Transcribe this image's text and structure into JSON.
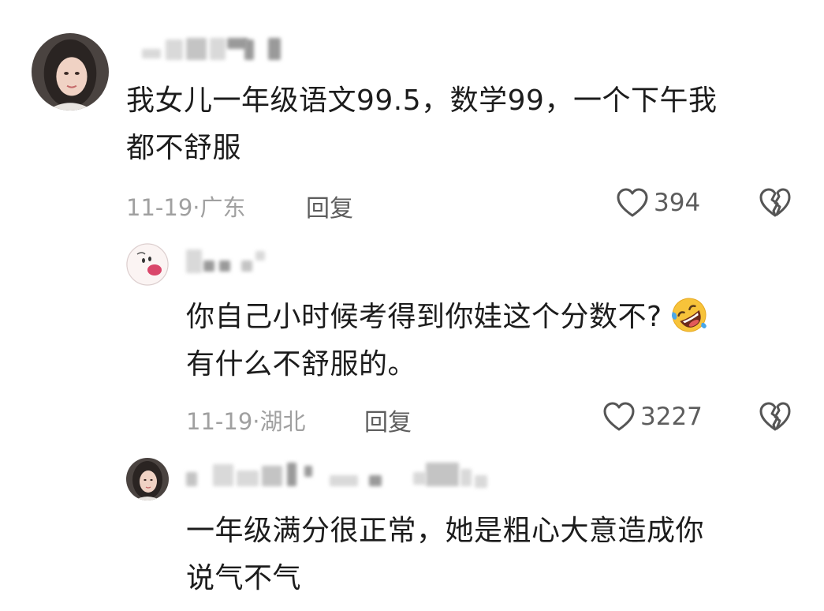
{
  "comments": [
    {
      "text_lines": [
        "我女儿一年级语文99.5，数学99，一个下午我",
        "都不舒服"
      ],
      "date": "11-19",
      "location": "广东",
      "reply_label": "回复",
      "likes": "394"
    },
    {
      "text_lines": [
        "你自己小时候考得到你娃这个分数不?",
        "有什么不舒服的。"
      ],
      "emoji": "rolling-on-floor-laughing",
      "date": "11-19",
      "location": "湖北",
      "reply_label": "回复",
      "likes": "3227"
    },
    {
      "text_lines": [
        "一年级满分很正常，她是粗心大意造成你",
        "说气不气"
      ]
    }
  ],
  "separator": "·",
  "colors": {
    "text": "#1c1c1c",
    "meta": "#a0a0a0",
    "action": "#5d5d5d"
  }
}
